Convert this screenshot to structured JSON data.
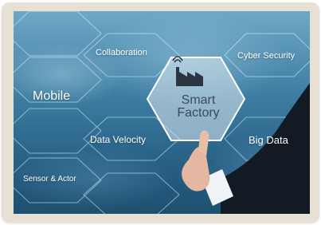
{
  "image": {
    "labels": {
      "collaboration": "Collaboration",
      "cyber_security": "Cyber Security",
      "mobile": "Mobile",
      "smart_line1": "Smart",
      "smart_line2": "Factory",
      "data_velocity": "Data Velocity",
      "big_data": "Big Data",
      "sensor_actor": "Sensor & Actor"
    },
    "icons": {
      "center": "factory-icon",
      "signal": "wifi-signal-icon"
    },
    "colors": {
      "frame": "#e7e1d3",
      "hex_lines": "#d9f1ff",
      "center_hex": "#dfe9f1",
      "text": "#ffffff",
      "center_text": "#3b4a5a",
      "sleeve": "#121a24"
    }
  }
}
